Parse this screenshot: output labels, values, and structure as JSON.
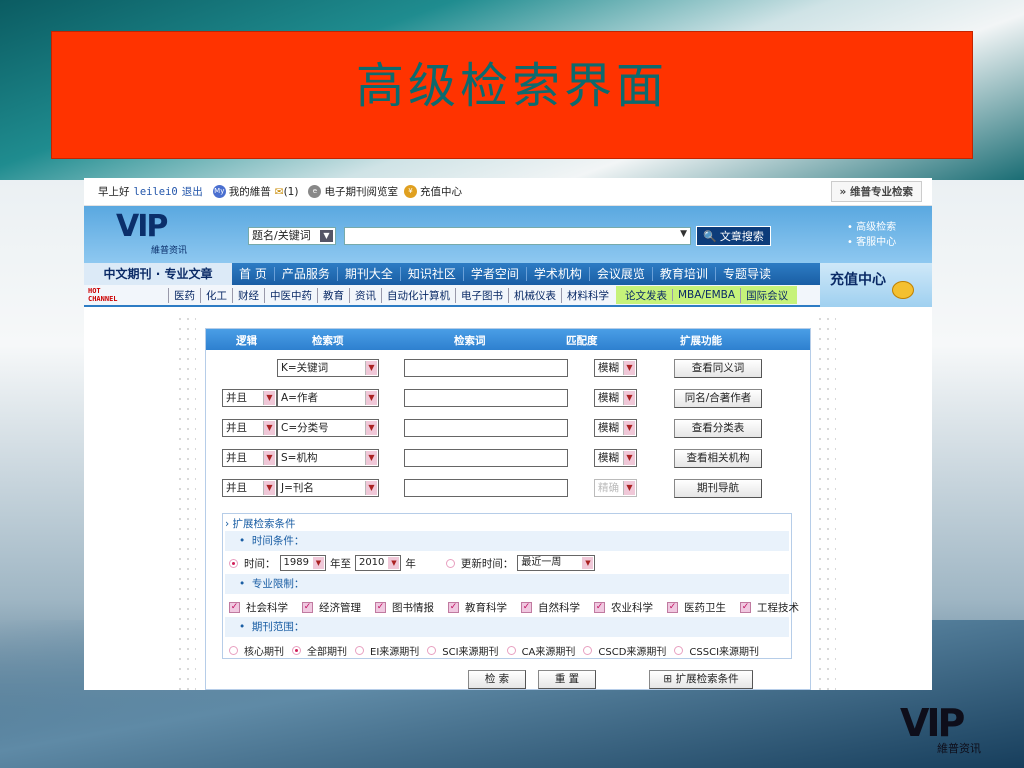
{
  "slide": {
    "title": "高级检索界面"
  },
  "topbar": {
    "greeting": "早上好",
    "username": "leilei0",
    "logout": "退出",
    "my_label": "我的維普",
    "mail_count": "(1)",
    "reading_room": "电子期刊阅览室",
    "recharge": "充值中心",
    "pro_search": "维普专业检索"
  },
  "header": {
    "logo_text": "VIP",
    "logo_sub": "維普资讯",
    "field_select": "题名/关键词",
    "search_button": "文章搜索",
    "links": [
      "• 高级检索",
      "• 客服中心"
    ]
  },
  "nav": {
    "brand": "中文期刊 · 专业文章",
    "items": [
      "首 页",
      "产品服务",
      "期刊大全",
      "知识社区",
      "学者空间",
      "学术机构",
      "会议展览",
      "教育培训",
      "专题导读"
    ],
    "recharge": "充值中心"
  },
  "subnav": {
    "hot": "HOT CHANNEL",
    "items": [
      "医药",
      "化工",
      "财经",
      "中医中药",
      "教育",
      "资讯",
      "自动化计算机",
      "电子图书",
      "机械仪表",
      "材料科学"
    ],
    "green_items": [
      "论文发表",
      "MBA/EMBA",
      "国际会议"
    ]
  },
  "form": {
    "headers": {
      "logic": "逻辑",
      "field": "检索项",
      "term": "检索词",
      "match": "匹配度",
      "ext": "扩展功能"
    },
    "rows": [
      {
        "logic": "",
        "field": "K=关键词",
        "match": "模糊",
        "button": "查看同义词"
      },
      {
        "logic": "并且",
        "field": "A=作者",
        "match": "模糊",
        "button": "同名/合著作者"
      },
      {
        "logic": "并且",
        "field": "C=分类号",
        "match": "模糊",
        "button": "查看分类表"
      },
      {
        "logic": "并且",
        "field": "S=机构",
        "match": "模糊",
        "button": "查看相关机构"
      },
      {
        "logic": "并且",
        "field": "J=刊名",
        "match": "精确",
        "button": "期刊导航"
      }
    ]
  },
  "ext": {
    "title": "扩展检索条件",
    "time_band": "时间条件：",
    "time_label": "时间：",
    "year_from": "1989",
    "to_label": "年至",
    "year_to": "2010",
    "year_suffix": "年",
    "update_label": "更新时间：",
    "update_value": "最近一周",
    "subject_band": "专业限制：",
    "subjects": [
      "社会科学",
      "经济管理",
      "图书情报",
      "教育科学",
      "自然科学",
      "农业科学",
      "医药卫生",
      "工程技术"
    ],
    "range_band": "期刊范围：",
    "ranges": [
      "核心期刊",
      "全部期刊",
      "EI来源期刊",
      "SCI来源期刊",
      "CA来源期刊",
      "CSCD来源期刊",
      "CSSCI来源期刊"
    ]
  },
  "actions": {
    "search": "检 索",
    "reset": "重 置",
    "expand": "扩展检索条件"
  },
  "corner_logo": {
    "text": "VIP",
    "sub": "維普资讯"
  }
}
